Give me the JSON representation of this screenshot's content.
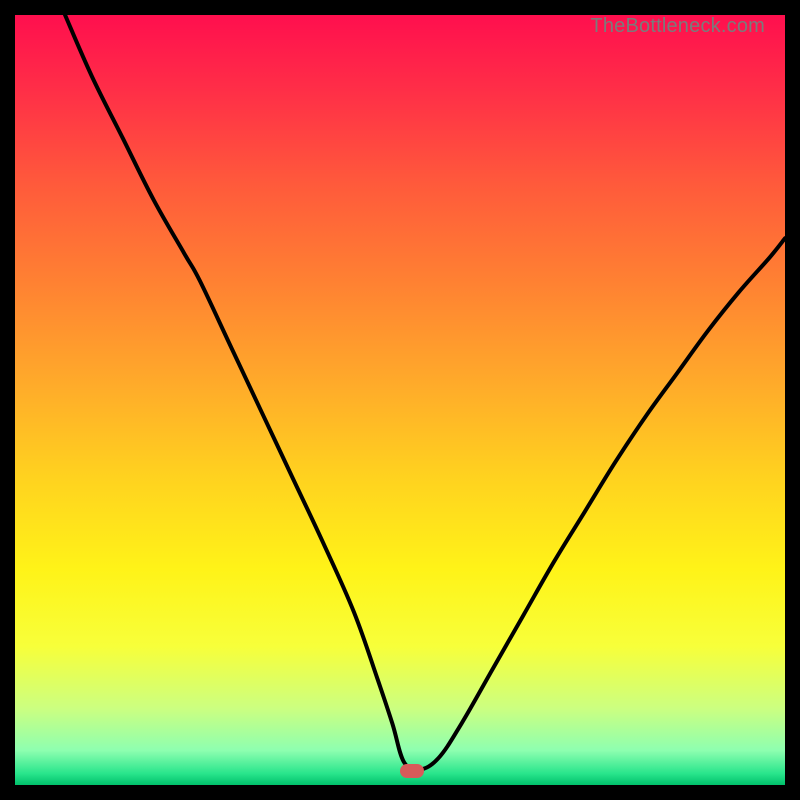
{
  "watermark": {
    "text": "TheBottleneck.com"
  },
  "colors": {
    "frame_bg": "#000000",
    "curve_stroke": "#000000",
    "marker_fill": "#d85a5a",
    "gradient_stops": [
      {
        "offset": 0.0,
        "color": "#ff0f4e"
      },
      {
        "offset": 0.1,
        "color": "#ff2f47"
      },
      {
        "offset": 0.22,
        "color": "#ff5a3b"
      },
      {
        "offset": 0.35,
        "color": "#ff8232"
      },
      {
        "offset": 0.48,
        "color": "#ffab2a"
      },
      {
        "offset": 0.6,
        "color": "#ffd21f"
      },
      {
        "offset": 0.72,
        "color": "#fff318"
      },
      {
        "offset": 0.82,
        "color": "#f7ff3a"
      },
      {
        "offset": 0.9,
        "color": "#ccff80"
      },
      {
        "offset": 0.955,
        "color": "#8effb0"
      },
      {
        "offset": 0.985,
        "color": "#29e58c"
      },
      {
        "offset": 1.0,
        "color": "#00c06b"
      }
    ]
  },
  "chart_data": {
    "type": "line",
    "title": "",
    "xlabel": "",
    "ylabel": "",
    "xlim": [
      0,
      100
    ],
    "ylim": [
      0,
      100
    ],
    "annotations": [
      {
        "kind": "marker",
        "x": 51.5,
        "y": 1.8,
        "shape": "pill",
        "color": "#d85a5a"
      }
    ],
    "series": [
      {
        "name": "bottleneck-curve",
        "x": [
          6.5,
          10,
          14,
          18,
          22,
          24,
          28,
          32,
          36,
          40,
          44,
          47,
          49,
          50.5,
          52.5,
          55,
          58,
          62,
          66,
          70,
          74,
          78,
          82,
          86,
          90,
          94,
          98,
          100
        ],
        "y": [
          100,
          92,
          84,
          76,
          69,
          65.5,
          57,
          48.5,
          40,
          31.5,
          22.5,
          14,
          8,
          3,
          2,
          3.5,
          8,
          15,
          22,
          29,
          35.5,
          42,
          48,
          53.5,
          59,
          64,
          68.5,
          71
        ]
      }
    ]
  }
}
